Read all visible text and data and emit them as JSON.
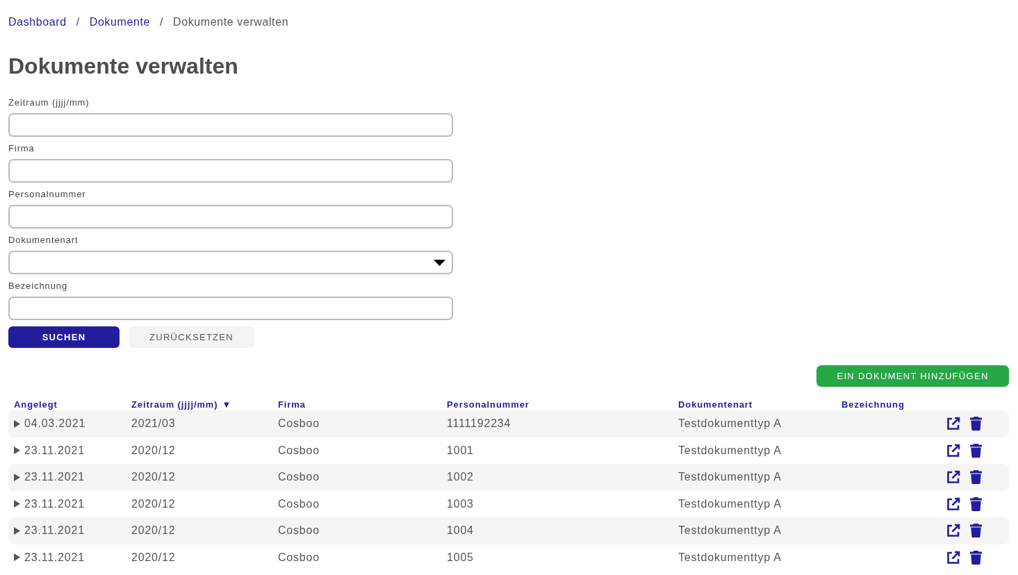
{
  "breadcrumb": [
    {
      "label": "Dashboard",
      "kind": "link"
    },
    {
      "label": "Dokumente",
      "kind": "link"
    },
    {
      "label": "Dokumente verwalten",
      "kind": "current"
    }
  ],
  "breadcrumb_separator": "/",
  "title": "Dokumente verwalten",
  "filters": [
    {
      "label": "Zeitraum (jjjj/mm)",
      "kind": "text"
    },
    {
      "label": "Firma",
      "kind": "text"
    },
    {
      "label": "Personalnummer",
      "kind": "text"
    },
    {
      "label": "Dokumentenart",
      "kind": "select"
    },
    {
      "label": "Bezeichnung",
      "kind": "text"
    }
  ],
  "buttons": [
    {
      "label": "SUCHEN",
      "kind": "primary"
    },
    {
      "label": "ZURÜCKSETZEN",
      "kind": "secondary"
    }
  ],
  "add_button": "EIN DOKUMENT HINZUFÜGEN",
  "table": {
    "columns": [
      {
        "label": "Angelegt"
      },
      {
        "label": "Zeitraum (jjjj/mm)",
        "sort_mark": "▼"
      },
      {
        "label": "Firma"
      },
      {
        "label": "Personalnummer"
      },
      {
        "label": "Dokumentenart"
      },
      {
        "label": "Bezeichnung"
      }
    ],
    "rows": [
      [
        "04.03.2021",
        "2021/03",
        "Cosboo",
        "1111192234",
        "Testdokumenttyp A"
      ],
      [
        "23.11.2021",
        "2020/12",
        "Cosboo",
        "1001",
        "Testdokumenttyp A"
      ],
      [
        "23.11.2021",
        "2020/12",
        "Cosboo",
        "1002",
        "Testdokumenttyp A"
      ],
      [
        "23.11.2021",
        "2020/12",
        "Cosboo",
        "1003",
        "Testdokumenttyp A"
      ],
      [
        "23.11.2021",
        "2020/12",
        "Cosboo",
        "1004",
        "Testdokumenttyp A"
      ],
      [
        "23.11.2021",
        "2020/12",
        "Cosboo",
        "1005",
        "Testdokumenttyp A"
      ]
    ]
  }
}
